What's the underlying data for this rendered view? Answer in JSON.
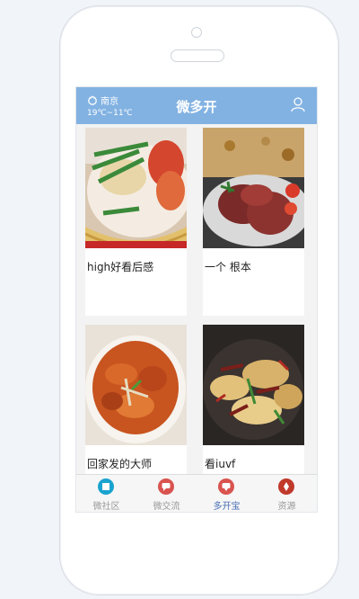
{
  "header": {
    "city": "南京",
    "temperature": "19℃~11℃",
    "title": "微多开",
    "weather_icon": "cloud-icon",
    "user_icon": "user-icon"
  },
  "cards": [
    {
      "caption": "high好看后感",
      "image": "lobster-dish-photo"
    },
    {
      "caption": "一个 根本",
      "image": "beef-pizza-photo"
    },
    {
      "caption": "回家发的大师",
      "image": "braised-meat-photo"
    },
    {
      "caption": "看iuvf",
      "image": "stir-fry-potato-photo"
    }
  ],
  "tabs": [
    {
      "label": "微社区",
      "icon": "community-icon",
      "color": "#1aa3cf",
      "active": false
    },
    {
      "label": "微交流",
      "icon": "chat-icon",
      "color": "#d9534f",
      "active": false
    },
    {
      "label": "多开宝",
      "icon": "chat-bubble-icon",
      "color": "#d9534f",
      "active": true
    },
    {
      "label": "资源",
      "icon": "resource-icon",
      "color": "#c0392b",
      "active": false
    }
  ],
  "colors": {
    "header_bg": "#82b2e2",
    "active_tab": "#4a6fb5"
  }
}
